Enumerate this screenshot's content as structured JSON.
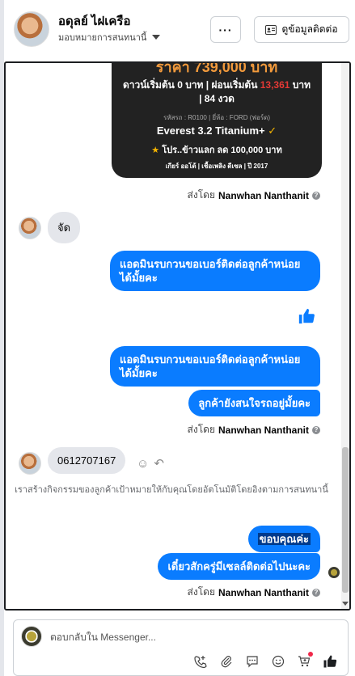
{
  "header": {
    "contact_name": "อดุลย์ ไฝเครือ",
    "assign_label": "มอบหมายการสนทนานี้",
    "more_label": "···",
    "info_label": "ดูข้อมูลติดต่อ"
  },
  "card": {
    "price": "ราคา 739,000 บาท",
    "down_prefix": "ดาวน์เริ่มต้น 0 บาท | ผ่อนเริ่มต้น ",
    "down_amount": "13,361",
    "down_suffix": " บาท",
    "term": "| 84 งวด",
    "code": "รหัสรถ : R0100 | ยี่ห้อ : FORD (ฟอร์ด)",
    "model": "Everest 3.2 Titanium+",
    "promo": "โปร..ข้าวแลก ลด 100,000 บาท",
    "specs": "เกียร์ ออโต้   |   เชื้อเพลิง ดีเซล   |   ปี 2017"
  },
  "sent_by_prefix": "ส่งโดย",
  "sent_by_name": "Nanwhan Nanthanit",
  "messages": {
    "in1": "จัด",
    "out1": "แอดมินรบกวนขอเบอร์ติดต่อลูกค้าหน่อยได้มั้ยคะ",
    "out2": "แอดมินรบกวนขอเบอร์ติดต่อลูกค้าหน่อยได้มั้ยคะ",
    "out3": "ลูกค้ายังสนใจรถอยู่มั้ยคะ",
    "in2": "0612707167",
    "system": "เราสร้างกิจกรรมของลูกค้าเป้าหมายให้กับคุณโดยอัตโนมัติโดยอิงตามการสนทนานี้",
    "out4": "ขอบคุณค่ะ",
    "out5": "เดี๋ยวสักครู่มีเซลล์ติดต่อไปนะคะ"
  },
  "composer": {
    "placeholder": "ตอบกลับใน Messenger..."
  },
  "icons": [
    "ellipsis-icon",
    "contact-card-icon",
    "thumbs-up-icon",
    "smile-icon",
    "reply-icon",
    "add-call-icon",
    "attachment-icon",
    "message-bubble-icon",
    "emoji-icon",
    "cart-icon"
  ]
}
